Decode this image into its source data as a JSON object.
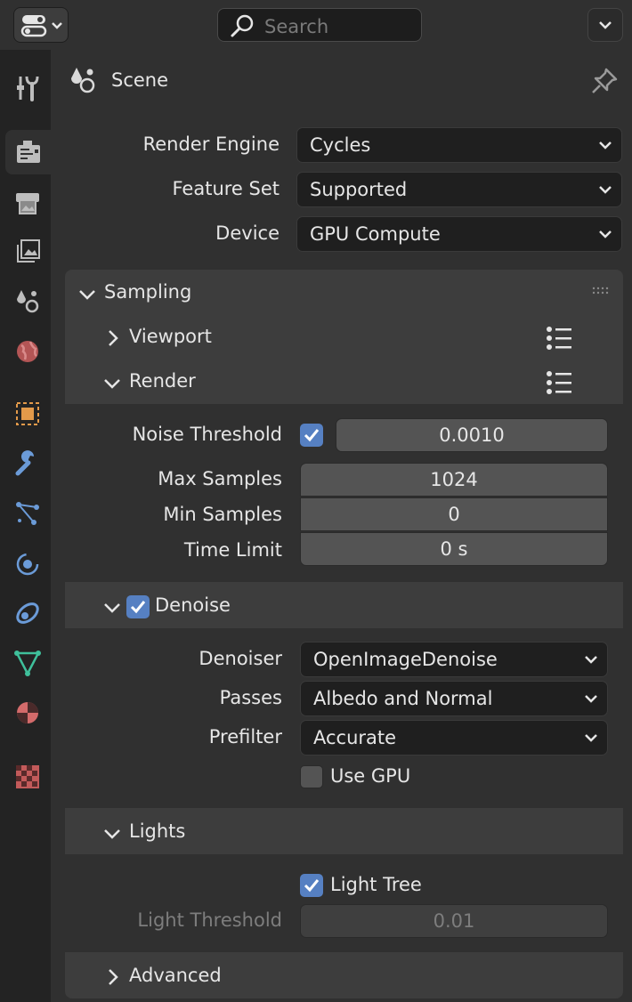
{
  "topbar": {
    "search_placeholder": "Search"
  },
  "sidebar": {
    "tabs": [
      "tool-icon",
      "render-icon",
      "output-icon",
      "view-layer-icon",
      "scene-icon",
      "world-icon",
      "object-icon",
      "modifier-icon",
      "particles-icon",
      "physics-icon",
      "constraints-icon",
      "data-icon",
      "material-icon",
      "texture-icon"
    ],
    "active_tab": "render-icon"
  },
  "header": {
    "title": "Scene"
  },
  "render": {
    "engine_label": "Render Engine",
    "engine_value": "Cycles",
    "featureset_label": "Feature Set",
    "featureset_value": "Supported",
    "device_label": "Device",
    "device_value": "GPU Compute"
  },
  "sampling": {
    "title": "Sampling",
    "viewport_label": "Viewport",
    "render_label": "Render",
    "noise_threshold_label": "Noise Threshold",
    "noise_threshold_enabled": true,
    "noise_threshold_value": "0.0010",
    "max_samples_label": "Max Samples",
    "max_samples_value": "1024",
    "min_samples_label": "Min Samples",
    "min_samples_value": "0",
    "time_limit_label": "Time Limit",
    "time_limit_value": "0 s",
    "denoise_label": "Denoise",
    "denoise_enabled": true,
    "denoiser_label": "Denoiser",
    "denoiser_value": "OpenImageDenoise",
    "passes_label": "Passes",
    "passes_value": "Albedo and Normal",
    "prefilter_label": "Prefilter",
    "prefilter_value": "Accurate",
    "use_gpu_label": "Use GPU",
    "use_gpu_enabled": false,
    "lights_label": "Lights",
    "light_tree_label": "Light Tree",
    "light_tree_enabled": true,
    "light_threshold_label": "Light Threshold",
    "light_threshold_value": "0.01",
    "advanced_label": "Advanced"
  },
  "colors": {
    "accent": "#5680c2",
    "panel": "#3d3d3d",
    "background": "#303030"
  }
}
